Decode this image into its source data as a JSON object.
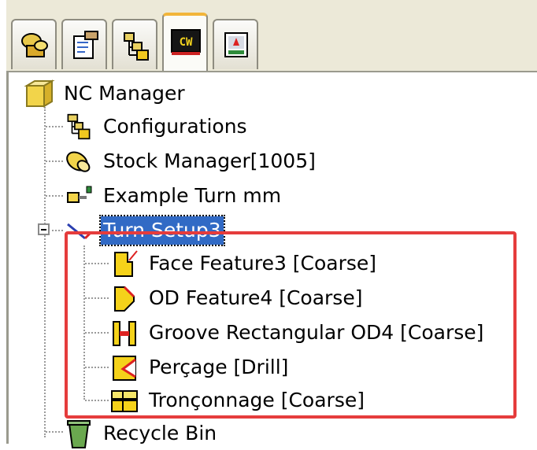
{
  "tabs": [
    {
      "icon": "feature-manager-icon",
      "active": false
    },
    {
      "icon": "property-manager-icon",
      "active": false
    },
    {
      "icon": "configuration-manager-icon",
      "active": false
    },
    {
      "icon": "camworks-icon",
      "label": "CW",
      "active": true
    },
    {
      "icon": "simulation-icon",
      "active": false
    }
  ],
  "tree": {
    "root": {
      "label": "NC Manager",
      "icon": "nc-manager-icon"
    },
    "items": [
      {
        "label": "Configurations",
        "icon": "configurations-icon"
      },
      {
        "label": "Stock Manager[1005]",
        "icon": "stock-manager-icon"
      },
      {
        "label": "Example Turn mm",
        "icon": "machine-icon"
      },
      {
        "label": "Turn Setup3",
        "icon": "turn-setup-icon",
        "selected": true,
        "expanded": true,
        "children": [
          {
            "label": "Face Feature3 [Coarse]",
            "icon": "face-feature-icon"
          },
          {
            "label": "OD Feature4 [Coarse]",
            "icon": "od-feature-icon"
          },
          {
            "label": "Groove Rectangular OD4 [Coarse]",
            "icon": "groove-icon"
          },
          {
            "label": "Perçage [Drill]",
            "icon": "drill-feature-icon"
          },
          {
            "label": "Tronçonnage [Coarse]",
            "icon": "cutoff-feature-icon"
          }
        ]
      },
      {
        "label": "Recycle Bin",
        "icon": "recycle-bin-icon"
      }
    ]
  },
  "colors": {
    "highlight": "#e53c3c",
    "selection": "#316ac5",
    "active_tab_accent": "#f2b53a"
  }
}
